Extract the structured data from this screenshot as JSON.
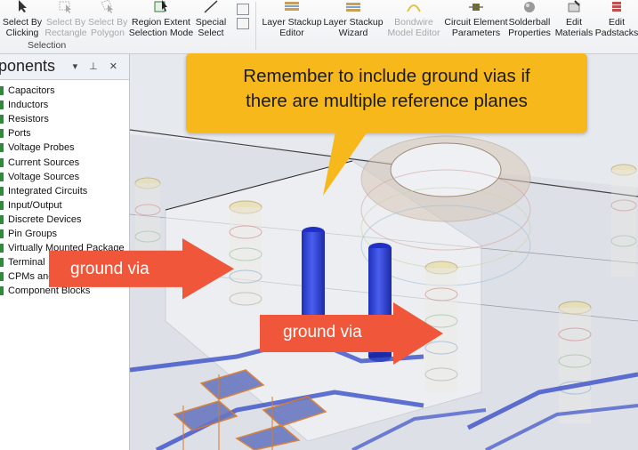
{
  "ribbon": {
    "buttons": [
      {
        "label": "Select By\nClicking",
        "disabled": false
      },
      {
        "label": "Select By\nRectangle",
        "disabled": true
      },
      {
        "label": "Select By\nPolygon",
        "disabled": true
      },
      {
        "label": "Region Extent\nSelection Mode",
        "disabled": false
      },
      {
        "label": "Special\nSelect",
        "disabled": false
      },
      {
        "label": "Layer Stackup\nEditor",
        "disabled": false
      },
      {
        "label": "Layer Stackup\nWizard",
        "disabled": false
      },
      {
        "label": "Bondwire\nModel Editor",
        "disabled": true
      },
      {
        "label": "Circuit Element\nParameters",
        "disabled": false
      },
      {
        "label": "Solderball\nProperties",
        "disabled": false
      },
      {
        "label": "Edit\nMaterials",
        "disabled": false
      },
      {
        "label": "Edit\nPadstacks",
        "disabled": false
      }
    ],
    "group_label": "Selection",
    "special_select_suffix": "▾"
  },
  "panel": {
    "title": "ponents",
    "controls": "▾ ⊥ ✕",
    "items": [
      "Capacitors",
      "Inductors",
      "Resistors",
      "Ports",
      "Voltage Probes",
      "Current Sources",
      "Voltage Sources",
      "Integrated Circuits",
      "Input/Output",
      "Discrete Devices",
      "Pin Groups",
      "Virtually Mounted Package",
      "Terminal",
      "CPMs and",
      "Component Blocks"
    ]
  },
  "callout": {
    "text": "Remember to include ground vias if\nthere are multiple reference planes"
  },
  "labels": {
    "left_arrow": "ground via",
    "right_arrow": "ground via"
  },
  "colors": {
    "callout": "#f6b81a",
    "arrow": "#f0563a",
    "signal_via": "#2f43d6",
    "trace": "#3a4fc9",
    "tree_icon": "#2e8b3a"
  }
}
